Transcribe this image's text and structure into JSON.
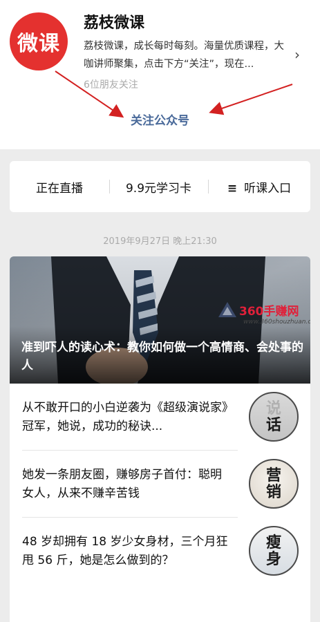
{
  "profile": {
    "logo_text": "微课",
    "name": "荔枝微课",
    "description": "荔枝微课，成长每时每刻。海量优质课程，大咖讲师聚集，点击下方“关注”，现在...",
    "friends": "6位朋友关注",
    "follow_label": "关注公众号",
    "chevron": "›",
    "brand_color": "#e4312f",
    "arrow_color": "#d32121"
  },
  "menu": {
    "items": [
      {
        "label": "正在直播"
      },
      {
        "label": "9.9元学习卡"
      },
      {
        "label": "听课入口",
        "icon": "menu-lines-icon",
        "icon_glyph": "≡"
      }
    ]
  },
  "timestamp": "2019年9月27日 晚上21:30",
  "articles": {
    "hero": {
      "title": "准到吓人的读心术：教你如何做一个高情商、会处事的人",
      "watermark_text": "360手赚网",
      "watermark_url": "www.360shouzhuan.com"
    },
    "rows": [
      {
        "title": "从不敢开口的小白逆袭为《超级演说家》冠军，她说，成功的秘诀...",
        "thumb_line1": "说",
        "thumb_line2": "话"
      },
      {
        "title": "她发一条朋友圈，赚够房子首付：聪明女人，从来不赚辛苦钱",
        "thumb_line1": "营",
        "thumb_line2": "销"
      },
      {
        "title": "48 岁却拥有 18 岁少女身材，三个月狂甩 56 斤，她是怎么做到的？",
        "thumb_line1": "瘦",
        "thumb_line2": "身"
      }
    ]
  }
}
